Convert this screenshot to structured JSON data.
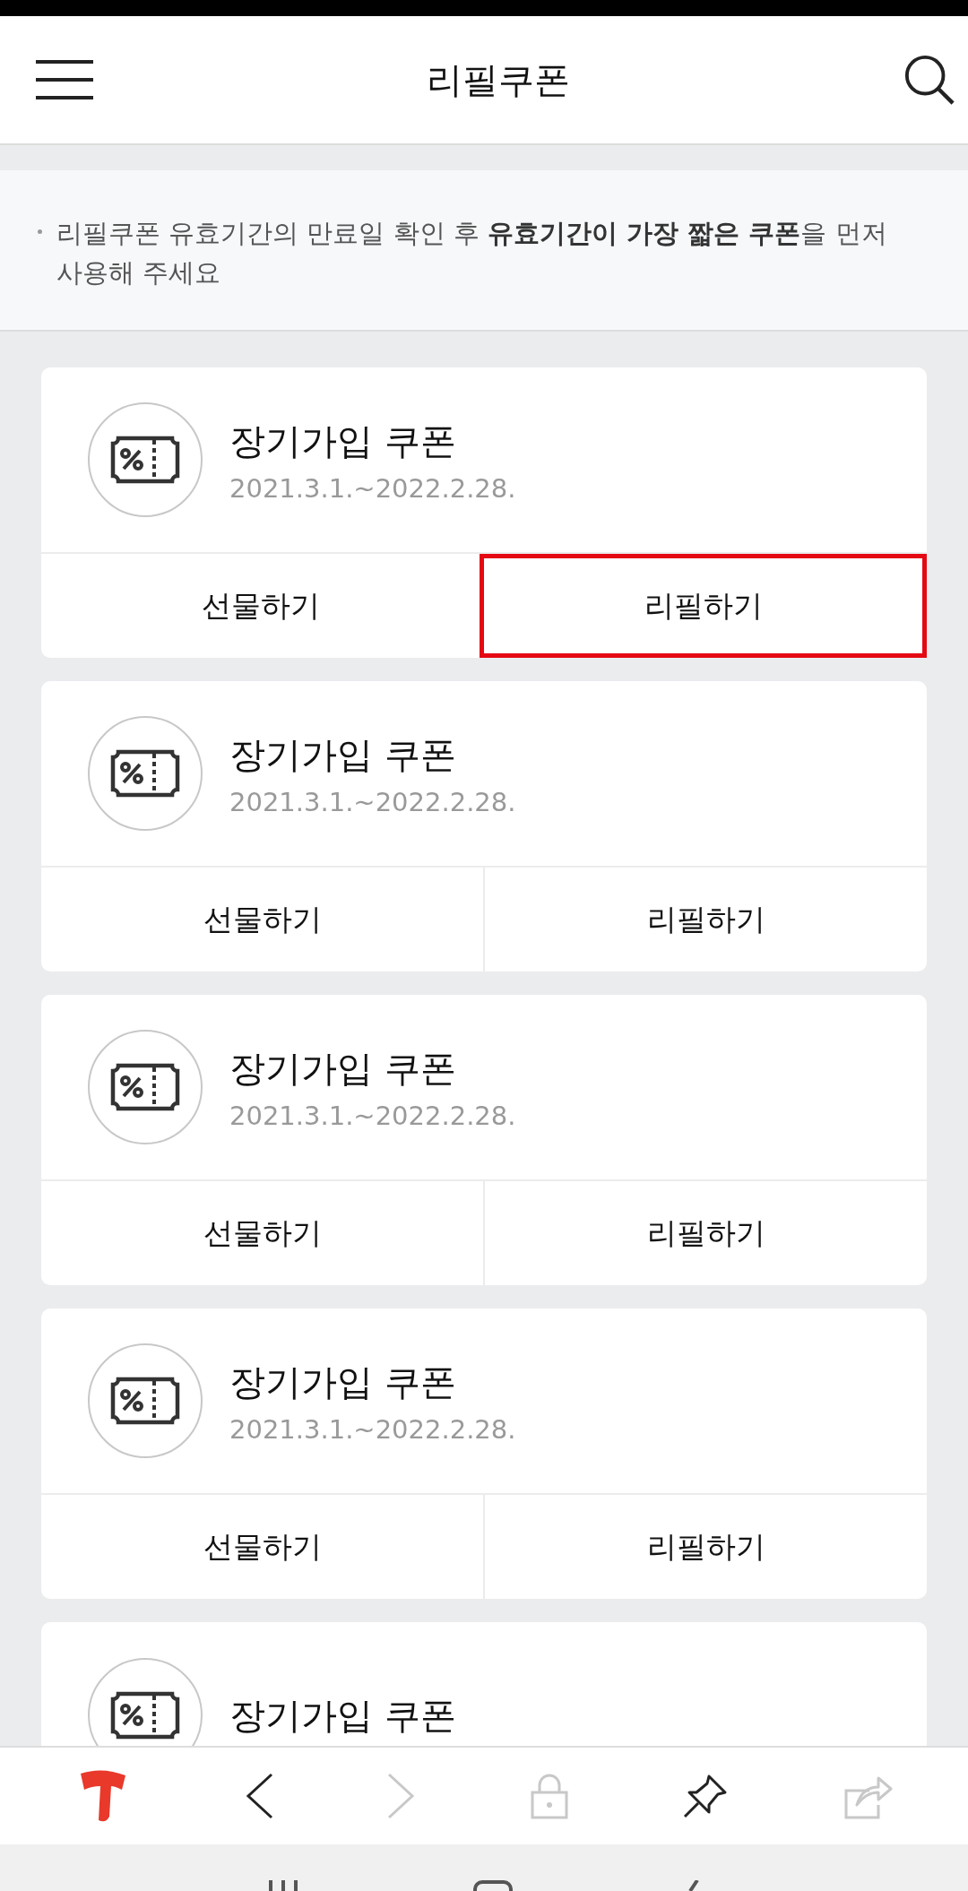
{
  "header": {
    "title": "리필쿠폰"
  },
  "notice": {
    "text": "리필쿠폰 유효기간의 만료일 확인 후 **유효기간이 가장 짧은 쿠폰**을 먼저 사용해 주세요"
  },
  "coupons": [
    {
      "title": "장기가입 쿠폰",
      "period": "2021.3.1.~2022.2.28.",
      "actions": [
        {
          "label": "선물하기",
          "highlighted": false
        },
        {
          "label": "리필하기",
          "highlighted": true
        }
      ]
    },
    {
      "title": "장기가입 쿠폰",
      "period": "2021.3.1.~2022.2.28.",
      "actions": [
        {
          "label": "선물하기",
          "highlighted": false
        },
        {
          "label": "리필하기",
          "highlighted": false
        }
      ]
    },
    {
      "title": "장기가입 쿠폰",
      "period": "2021.3.1.~2022.2.28.",
      "actions": [
        {
          "label": "선물하기",
          "highlighted": false
        },
        {
          "label": "리필하기",
          "highlighted": false
        }
      ]
    },
    {
      "title": "장기가입 쿠폰",
      "period": "2021.3.1.~2022.2.28.",
      "actions": [
        {
          "label": "선물하기",
          "highlighted": false
        },
        {
          "label": "리필하기",
          "highlighted": false
        }
      ]
    },
    {
      "title": "장기가입 쿠폰"
    }
  ],
  "browser_toolbar": [
    {
      "kind": "logo",
      "disabled": false
    },
    {
      "kind": "back",
      "disabled": false
    },
    {
      "kind": "forward",
      "disabled": true
    },
    {
      "kind": "lock",
      "disabled": true
    },
    {
      "kind": "pin",
      "disabled": false
    },
    {
      "kind": "share",
      "disabled": true
    }
  ],
  "system_nav": [
    {
      "kind": "recents"
    },
    {
      "kind": "home"
    },
    {
      "kind": "back"
    }
  ]
}
